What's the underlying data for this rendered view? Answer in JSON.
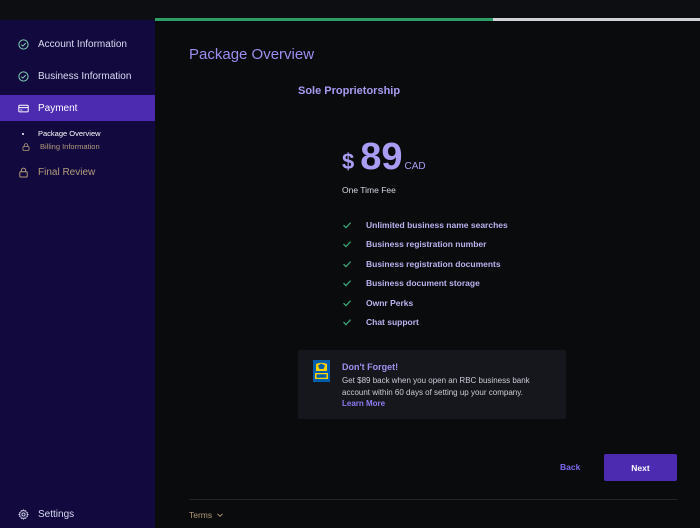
{
  "progress": {
    "fraction": 0.62
  },
  "sidebar": {
    "items": [
      {
        "label": "Account Information",
        "icon": "check-circle-icon",
        "state": "done"
      },
      {
        "label": "Business Information",
        "icon": "check-circle-icon",
        "state": "done"
      },
      {
        "label": "Payment",
        "icon": "card-icon",
        "state": "active"
      },
      {
        "label": "Final Review",
        "icon": "lock-icon",
        "state": "locked"
      }
    ],
    "subitems": [
      {
        "label": "Package Overview",
        "icon": "bullet",
        "state": "current"
      },
      {
        "label": "Billing Information",
        "icon": "lock-icon",
        "state": "locked"
      }
    ],
    "settings_label": "Settings"
  },
  "main": {
    "title": "Package Overview",
    "plan_name": "Sole Proprietorship",
    "price": {
      "currency_symbol": "$",
      "amount": "89",
      "currency_code": "CAD",
      "fee_label": "One Time Fee"
    },
    "features": [
      "Unlimited business name searches",
      "Business registration number",
      "Business registration documents",
      "Business document storage",
      "Ownr Perks",
      "Chat support"
    ],
    "promo": {
      "title": "Don't Forget!",
      "body": "Get $89 back when you open an RBC business bank account within 60 days of setting up your company.",
      "link": "Learn More"
    },
    "back_label": "Back",
    "next_label": "Next",
    "terms_label": "Terms"
  },
  "colors": {
    "sidebar_bg": "#120a3f",
    "accent": "#4c2bb1",
    "text_purple": "#a89cf2",
    "check_green": "#3fae7e",
    "progress_green": "#2e9e68",
    "locked_tan": "#b39b7a"
  }
}
